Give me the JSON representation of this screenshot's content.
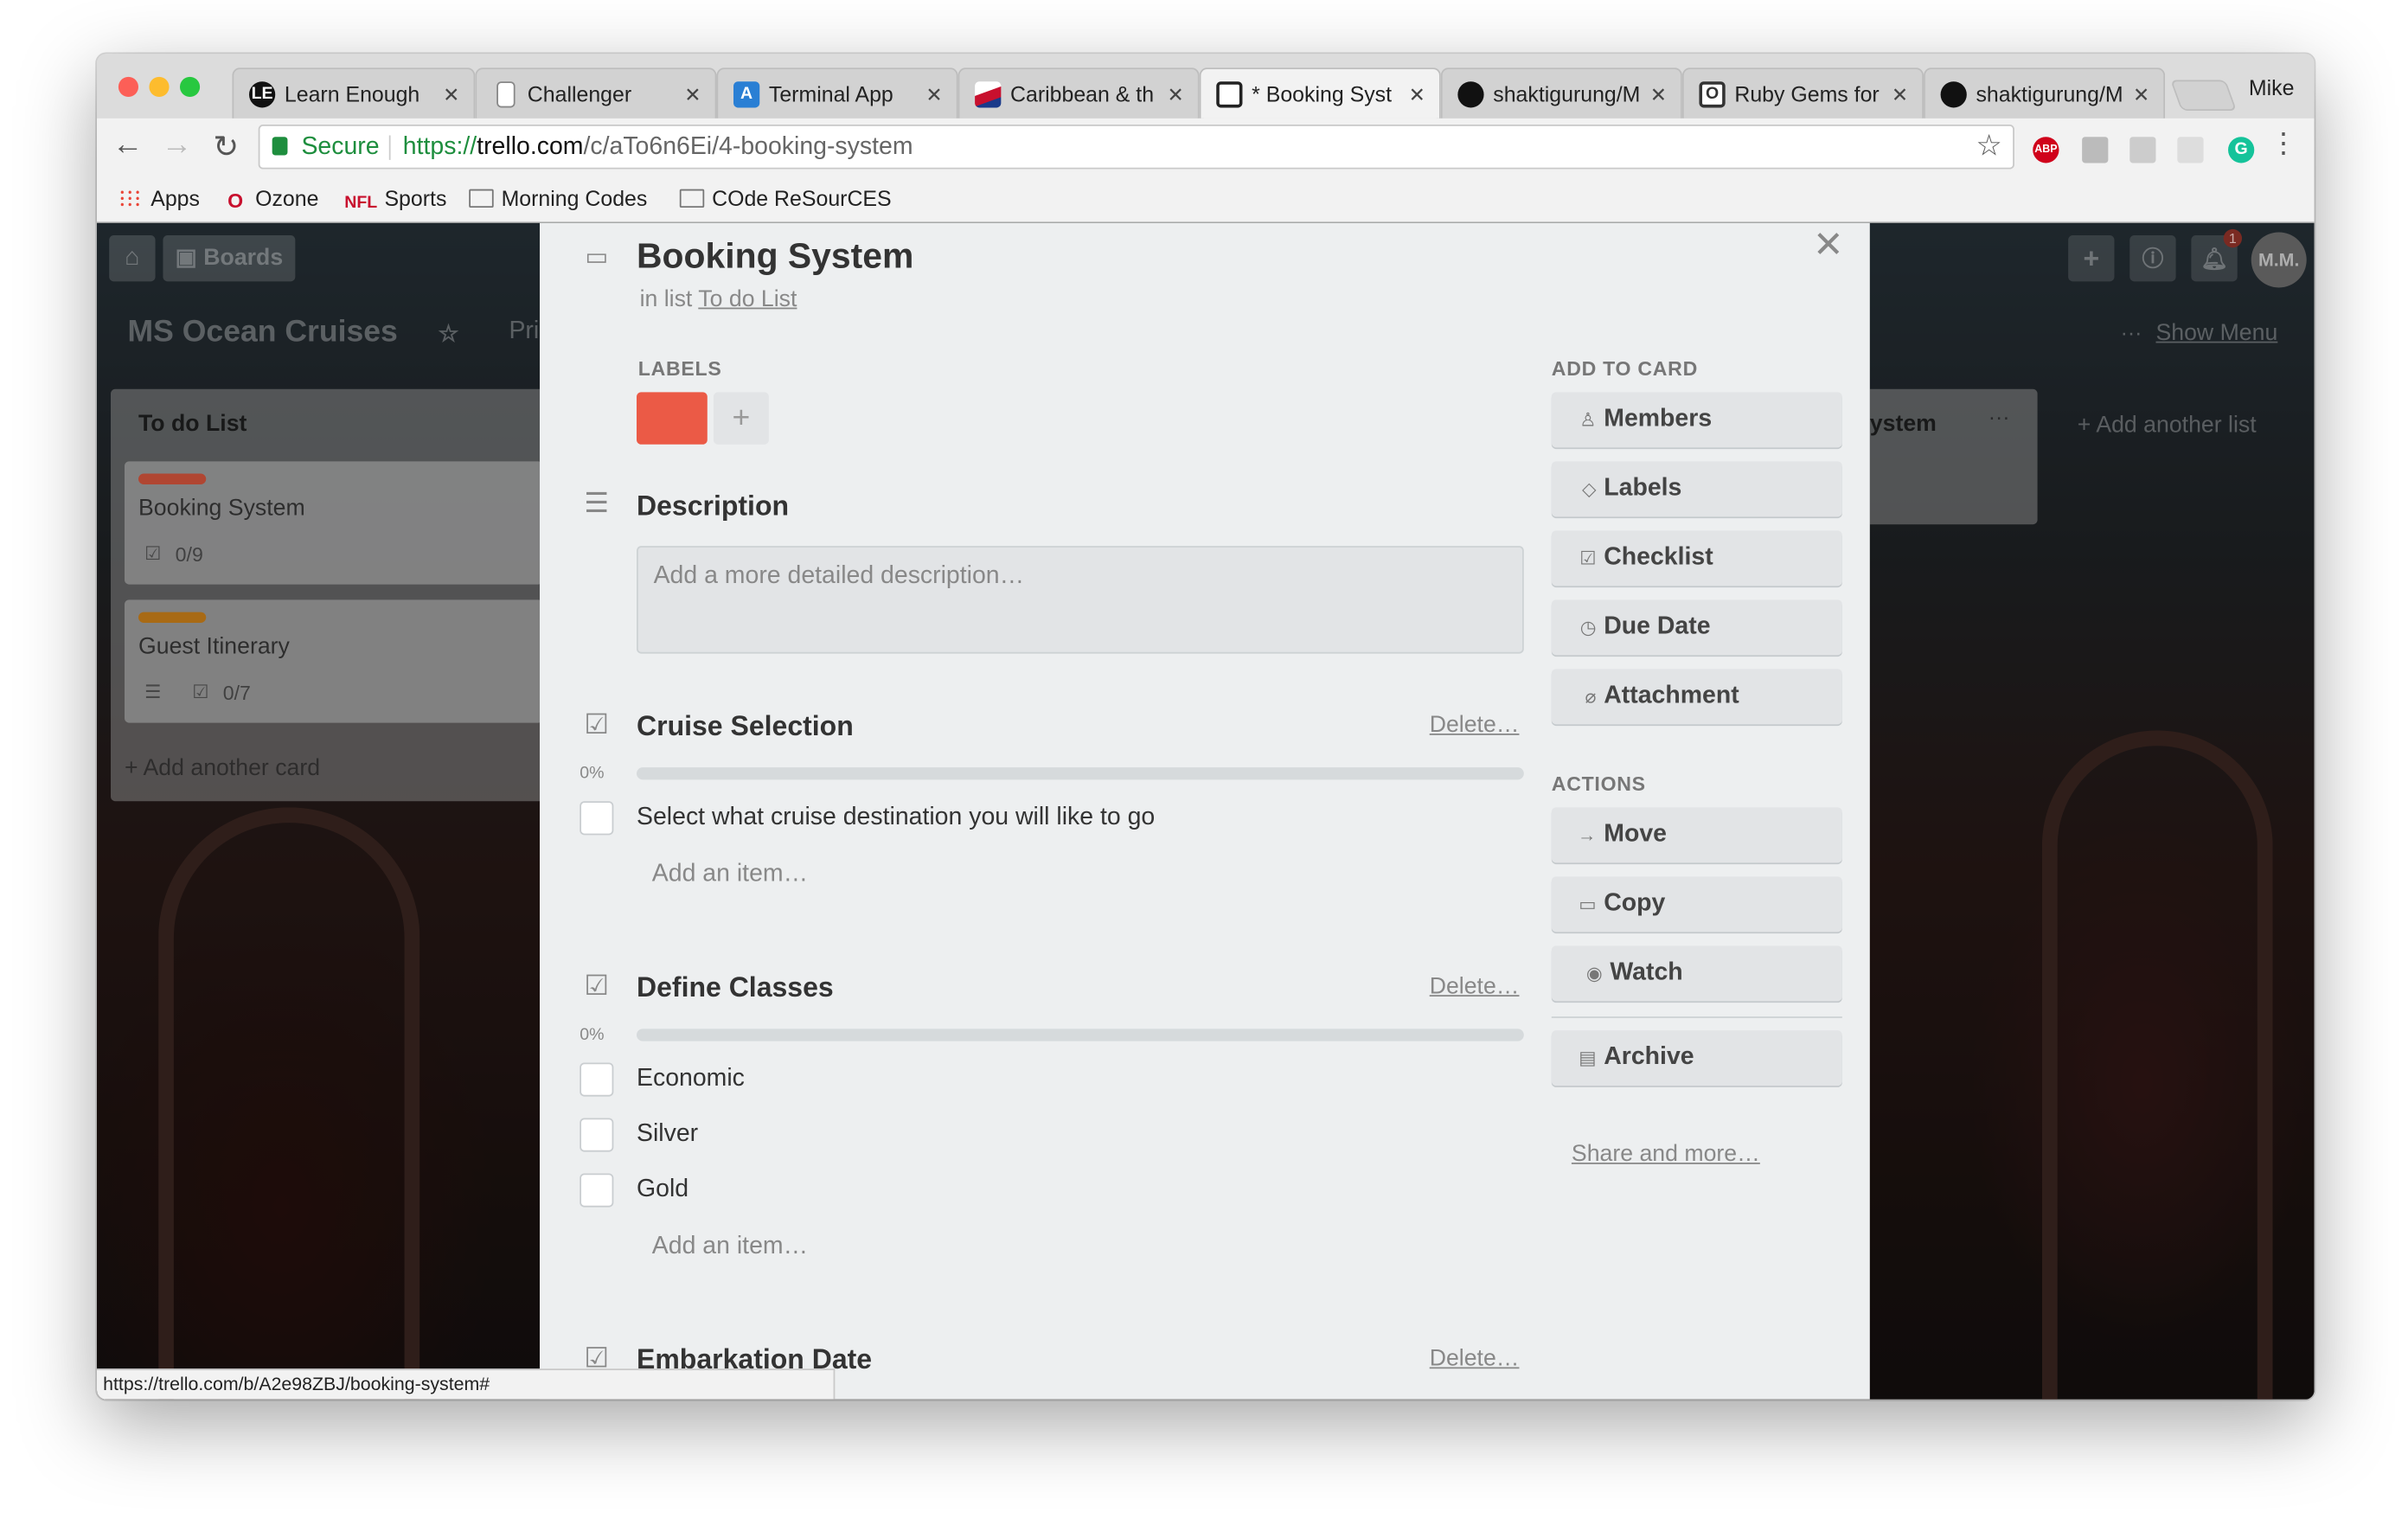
{
  "browser": {
    "tabs": [
      {
        "title": "Learn Enough",
        "icon": "learn-enough-icon",
        "fav": "LE",
        "color": "#111"
      },
      {
        "title": "Challenger",
        "icon": "page-icon",
        "fav": "",
        "color": "#fff"
      },
      {
        "title": "Terminal App",
        "icon": "terminal-app-icon",
        "fav": "A",
        "color": "#2a7fd4"
      },
      {
        "title": "Caribbean & th",
        "icon": "cruise-icon",
        "fav": "",
        "color": "#c8102e"
      },
      {
        "title": "* Booking Syst",
        "icon": "trello-icon",
        "fav": "",
        "color": "#222"
      },
      {
        "title": "shaktigurung/M",
        "icon": "github-icon",
        "fav": "",
        "color": "#111"
      },
      {
        "title": "Ruby Gems for",
        "icon": "ruby-gems-icon",
        "fav": "O",
        "color": "#333"
      },
      {
        "title": "shaktigurung/M",
        "icon": "github-icon",
        "fav": "",
        "color": "#111"
      }
    ],
    "profile": "Mike",
    "secure_label": "Secure",
    "url_scheme": "https://",
    "url_host": "trello.com",
    "url_path": "/c/aTo6n6Ei/4-booking-system",
    "bookmarks": [
      "Apps",
      "Ozone",
      "Sports",
      "Morning Codes",
      "COde ReSourCES"
    ],
    "ext_badge": "ABP",
    "status_url": "https://trello.com/b/A2e98ZBJ/booking-system#"
  },
  "board": {
    "boards_label": "Boards",
    "title": "MS Ocean Cruises",
    "privacy_fragment": "Pri",
    "show_menu": "Show Menu",
    "user_initials": "M.M.",
    "notification_count": "1",
    "list": {
      "title": "To do List",
      "cards": [
        {
          "title": "Booking System",
          "badge": "0/9",
          "label_color": "#b04632"
        },
        {
          "title": "Guest Itinerary",
          "badge": "0/7",
          "label_color": "#a86a15"
        }
      ],
      "add_card": "+ Add another card"
    },
    "right_list_fragment": "ystem",
    "add_another_list": "+ Add another list"
  },
  "card": {
    "title": "Booking System",
    "in_list_prefix": "in list",
    "list_name": "To do List",
    "labels_heading": "LABELS",
    "label_color": "#eb5a46",
    "description_heading": "Description",
    "description_placeholder": "Add a more detailed description…",
    "checklists": [
      {
        "title": "Cruise Selection",
        "percent": "0%",
        "progress": 0,
        "items": [
          "Select what cruise destination you will like to go"
        ]
      },
      {
        "title": "Define Classes",
        "percent": "0%",
        "progress": 0,
        "items": [
          "Economic",
          "Silver",
          "Gold"
        ]
      },
      {
        "title": "Embarkation Date",
        "percent": "",
        "progress": 0,
        "items": []
      }
    ],
    "delete_label": "Delete…",
    "add_item": "Add an item…"
  },
  "sidebar": {
    "add_to_card": "ADD TO CARD",
    "add_buttons": [
      "Members",
      "Labels",
      "Checklist",
      "Due Date",
      "Attachment"
    ],
    "actions_heading": "ACTIONS",
    "action_buttons": [
      "Move",
      "Copy",
      "Watch"
    ],
    "archive": "Archive",
    "share": "Share and more…"
  }
}
